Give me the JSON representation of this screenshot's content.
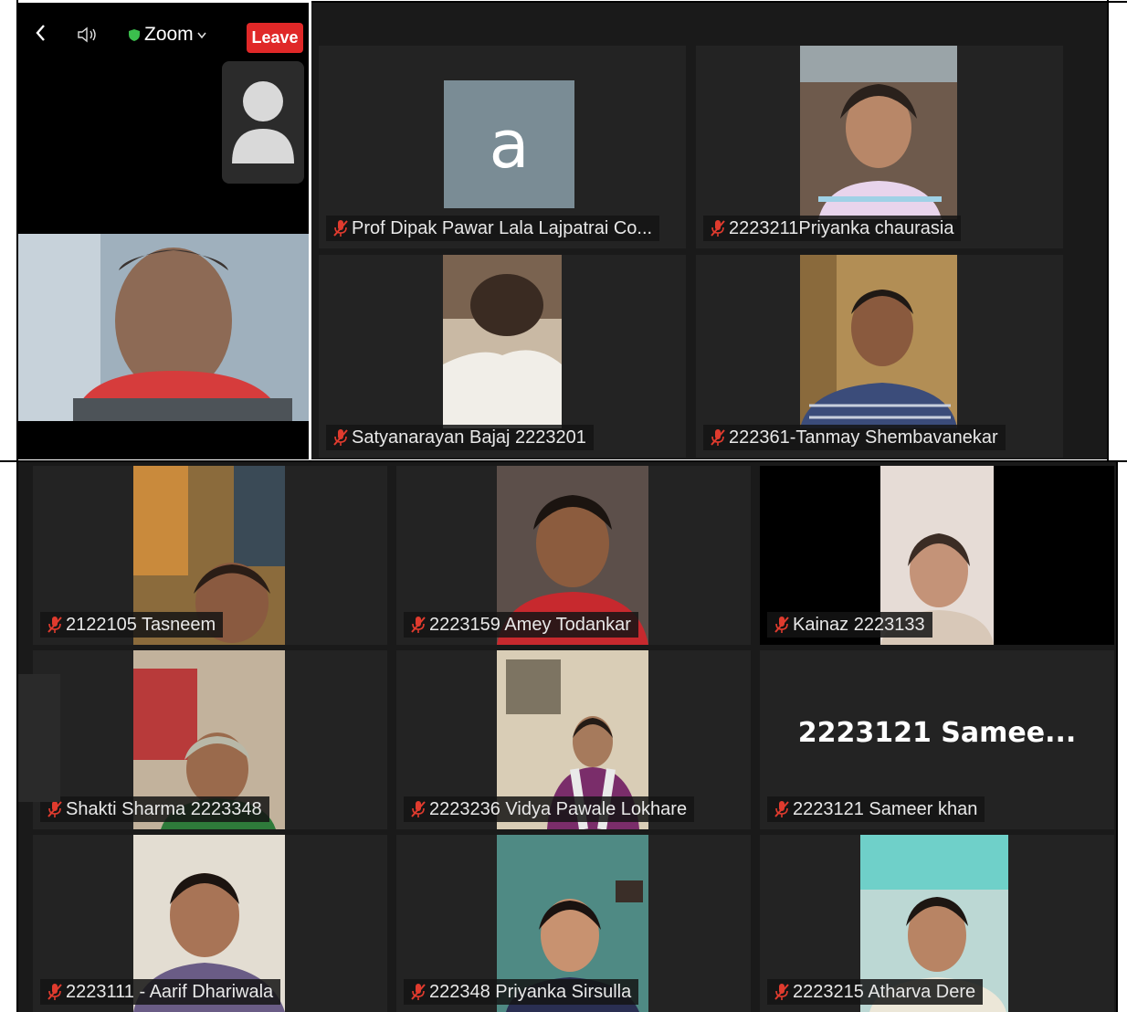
{
  "header": {
    "meeting_title": "Zoom",
    "leave_label": "Leave"
  },
  "colors": {
    "leave_red": "#e02828",
    "secure_green": "#3bbf4d",
    "tile_bg": "#232323",
    "muted_red": "#e03b2e"
  },
  "icons": [
    "back-icon",
    "speaker-icon",
    "shield-icon",
    "chevron-down-icon",
    "avatar-icon",
    "mic-muted-icon"
  ],
  "gallery_top": [
    {
      "name": "Prof Dipak Pawar Lala Lajpatrai Co...",
      "avatar_letter": "a"
    },
    {
      "name": "2223211Priyanka chaurasia"
    },
    {
      "name": "Satyanarayan Bajaj 2223201"
    },
    {
      "name": "222361-Tanmay Shembavanekar"
    }
  ],
  "gallery_bottom": [
    {
      "name": "2122105 Tasneem"
    },
    {
      "name": "2223159 Amey Todankar"
    },
    {
      "name": "Kainaz 2223133"
    },
    {
      "name": "Shakti Sharma 2223348"
    },
    {
      "name": "2223236 Vidya Pawale Lokhare"
    },
    {
      "name": "2223121 Sameer khan",
      "name_display": "2223121  Samee..."
    },
    {
      "name": "2223111 - Aarif Dhariwala"
    },
    {
      "name": "222348 Priyanka Sirsulla"
    },
    {
      "name": "2223215 Atharva Dere"
    }
  ]
}
